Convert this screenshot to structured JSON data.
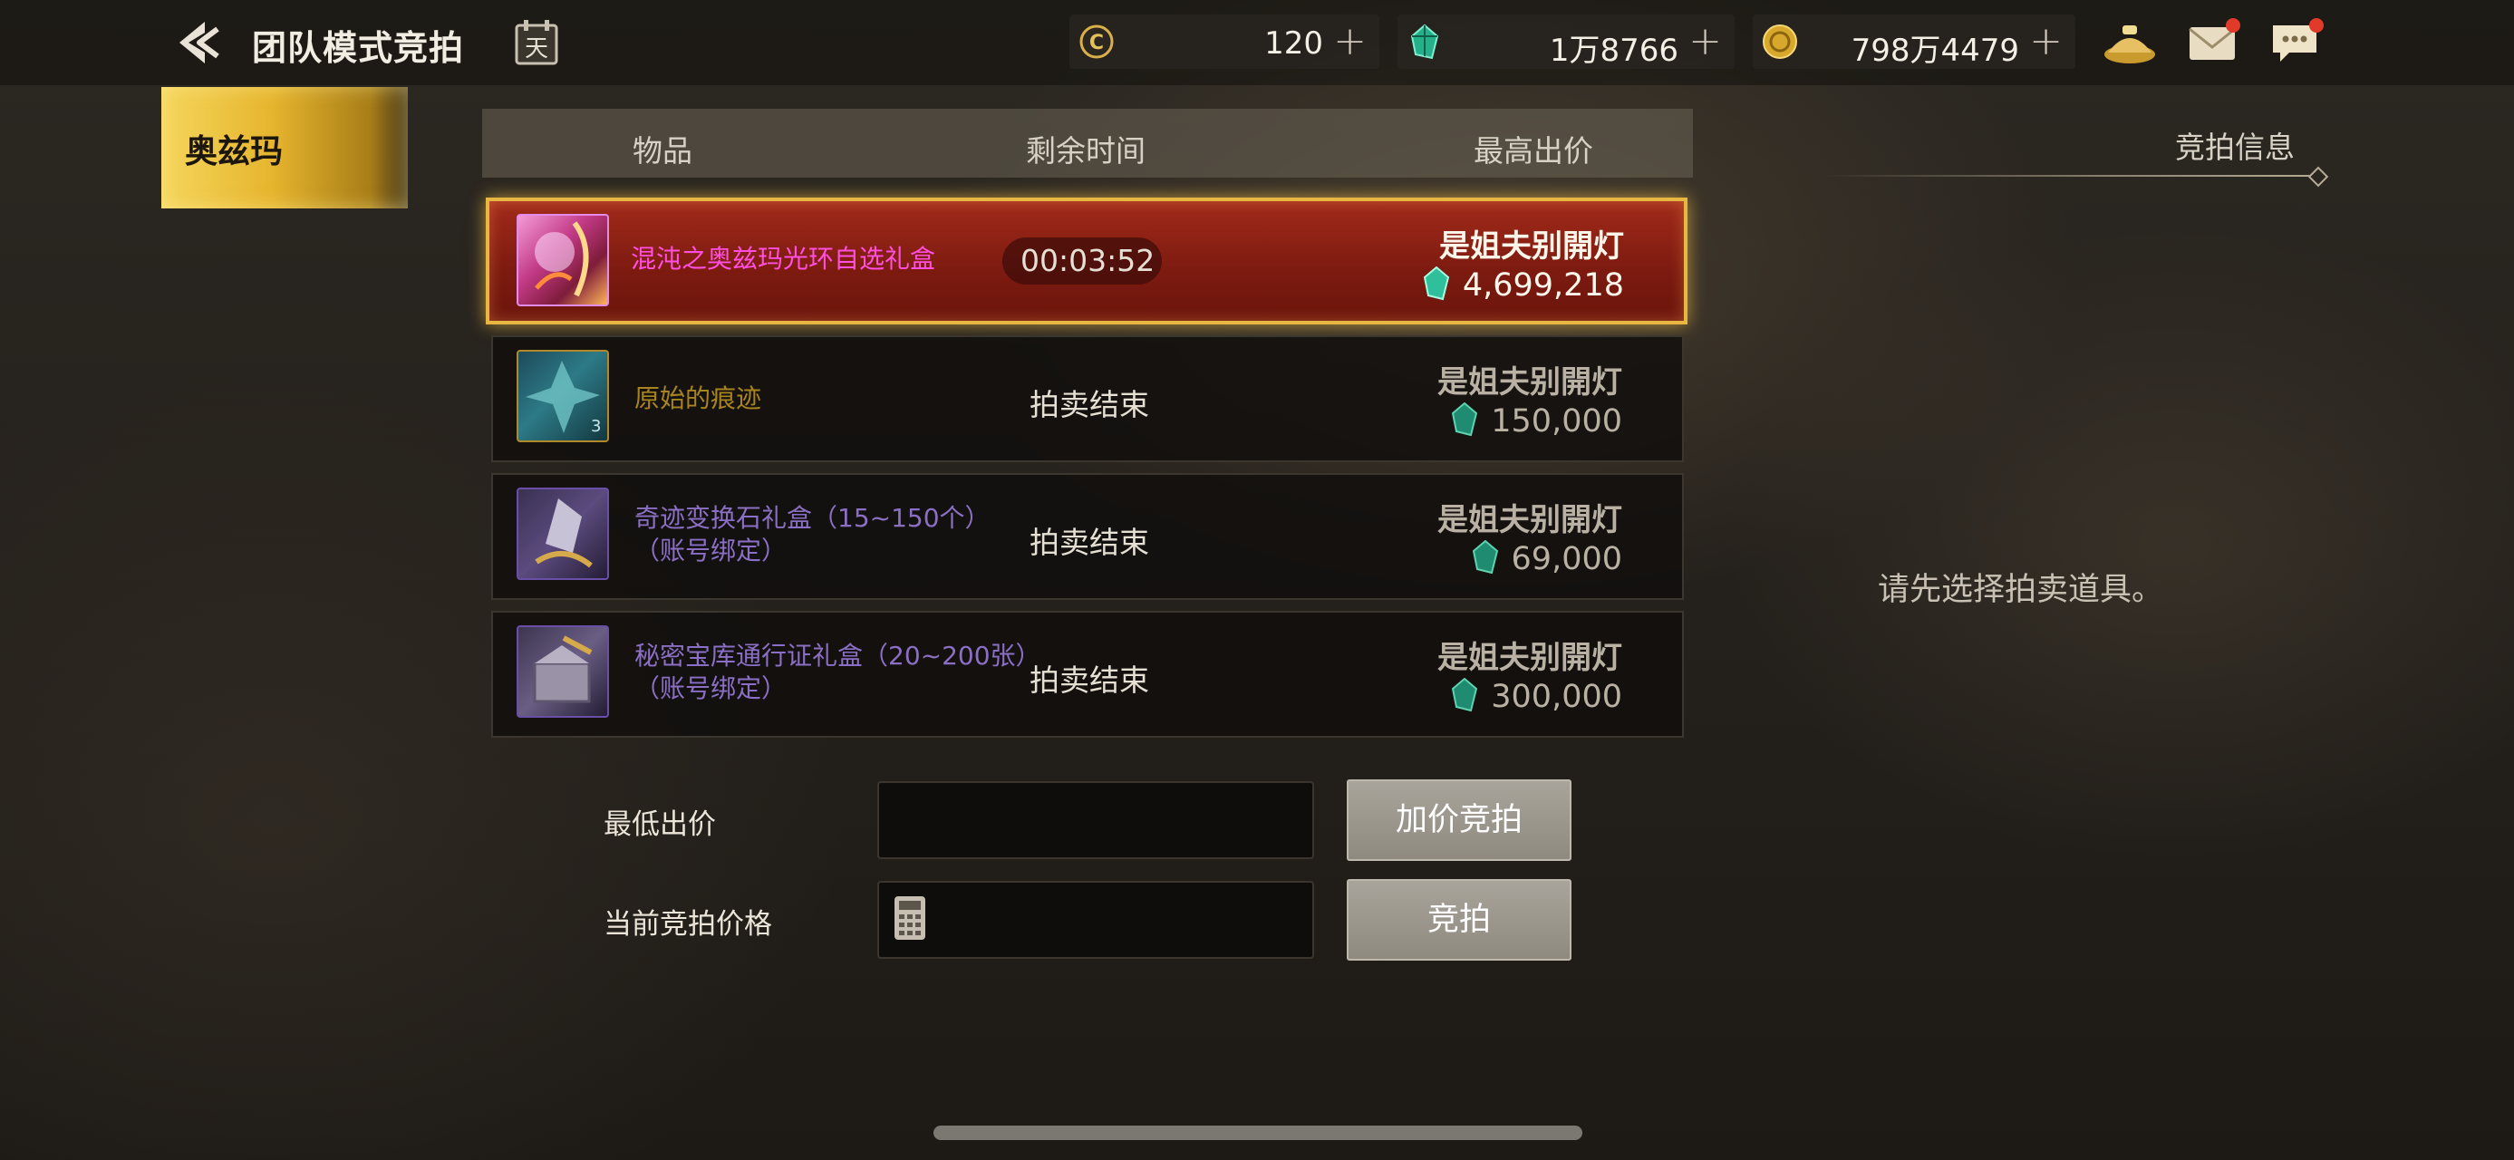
{
  "header": {
    "title": "团队模式竞拍",
    "calendar_icon_char": "天",
    "currencies": [
      {
        "icon": "coin-c-icon",
        "value": "120"
      },
      {
        "icon": "teal-gem-icon",
        "value": "1万8766"
      },
      {
        "icon": "gold-coin-icon",
        "value": "798万4479"
      }
    ],
    "plus": "+"
  },
  "left_tab": {
    "label": "奥兹玛"
  },
  "table": {
    "col_item": "物品",
    "col_time": "剩余时间",
    "col_bid": "最高出价"
  },
  "rows": [
    {
      "name": "混沌之奥兹玛光环自选礼盒",
      "name_line2": "",
      "time": "00:03:52",
      "bidder": "是姐夫别開灯",
      "price": "4,699,218",
      "name_color": "#ff4fe0",
      "active": true
    },
    {
      "name": "原始的痕迹",
      "name_line2": "",
      "time": "拍卖结束",
      "bidder": "是姐夫别開灯",
      "price": "150,000",
      "name_color": "#a8841f"
    },
    {
      "name": "奇迹变换石礼盒（15~150个）",
      "name_line2": "（账号绑定）",
      "time": "拍卖结束",
      "bidder": "是姐夫别開灯",
      "price": "69,000",
      "name_color": "#8b6fc4"
    },
    {
      "name": "秘密宝库通行证礼盒（20~200张）",
      "name_line2": "（账号绑定）",
      "time": "拍卖结束",
      "bidder": "是姐夫别開灯",
      "price": "300,000",
      "name_color": "#8b6fc4"
    }
  ],
  "bid_panel": {
    "min_bid_label": "最低出价",
    "min_bid_value": "",
    "current_bid_label": "当前竞拍价格",
    "current_bid_value": "",
    "raise_button": "加价竞拍",
    "bid_button": "竞拍"
  },
  "right_panel": {
    "heading": "竞拍信息",
    "message": "请先选择拍卖道具。"
  },
  "colors": {
    "accent_gold": "#e7b741",
    "active_row": "#8c2214",
    "gem": "#2fbf9a"
  }
}
